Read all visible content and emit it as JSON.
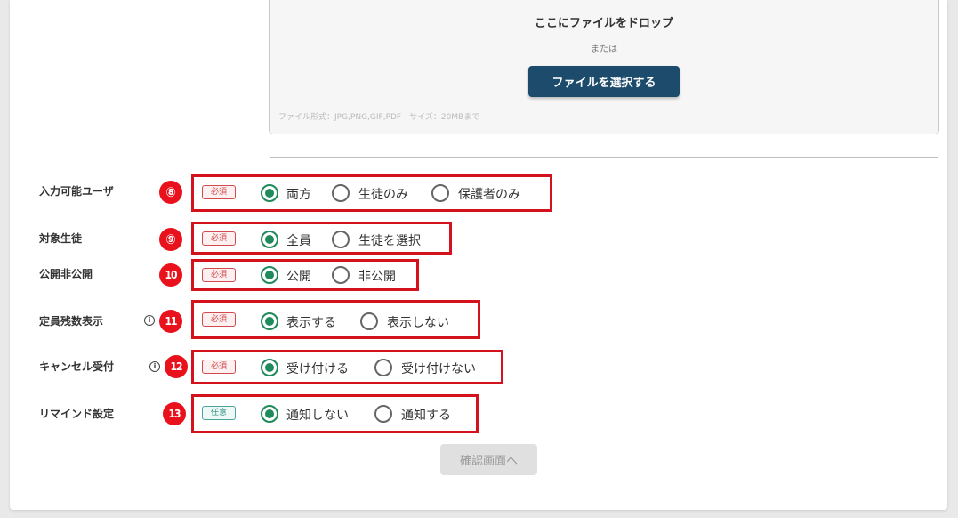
{
  "upload": {
    "drop_title": "ここにファイルをドロップ",
    "or_text": "または",
    "select_button": "ファイルを選択する",
    "note": "ファイル形式：JPG,PNG,GIF,PDF　サイズ：20MBまで"
  },
  "rows": [
    {
      "number": "⑧",
      "label": "入力可能ユーザ",
      "badge": "必須",
      "options": [
        "両方",
        "生徒のみ",
        "保護者のみ"
      ],
      "selected": "両方"
    },
    {
      "number": "⑨",
      "label": "対象生徒",
      "badge": "必須",
      "options": [
        "全員",
        "生徒を選択"
      ],
      "selected": "全員"
    },
    {
      "number": "10",
      "label": "公開非公開",
      "badge": "必須",
      "options": [
        "公開",
        "非公開"
      ],
      "selected": "公開"
    },
    {
      "number": "11",
      "label": "定員残数表示",
      "badge": "必須",
      "info_icon": "info-icon",
      "options": [
        "表示する",
        "表示しない"
      ],
      "selected": "表示する"
    },
    {
      "number": "12",
      "label": "キャンセル受付",
      "badge": "必須",
      "info_icon": "info-icon",
      "options": [
        "受け付ける",
        "受け付けない"
      ],
      "selected": "受け付ける"
    },
    {
      "number": "13",
      "label": "リマインド設定",
      "badge": "任意",
      "options": [
        "通知しない",
        "通知する"
      ],
      "selected": "通知しない"
    }
  ],
  "confirm_button": "確認画面へ",
  "colors": {
    "accent_red": "#d4121d",
    "radio_green": "#1f8a5b",
    "primary_button": "#1c4b6b"
  }
}
